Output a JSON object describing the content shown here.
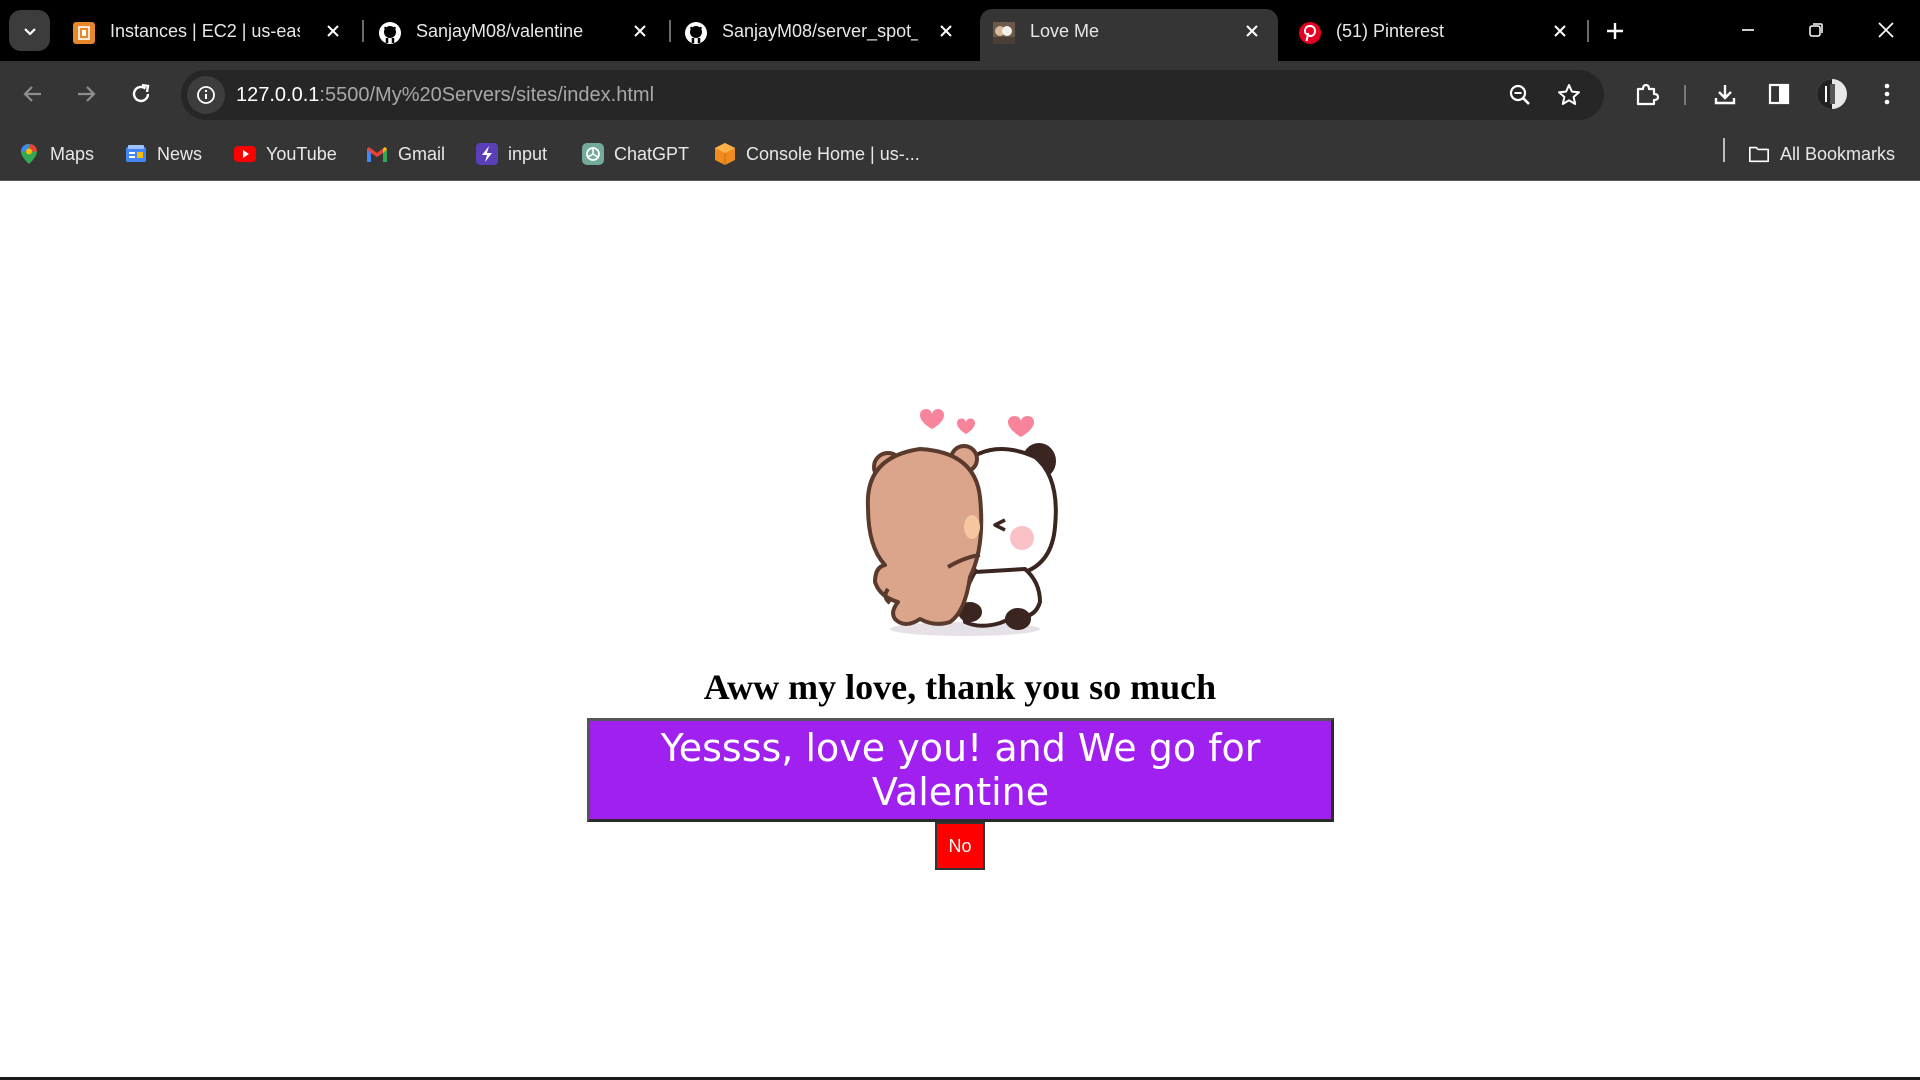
{
  "tabs": [
    {
      "title": "Instances | EC2 | us-east-",
      "icon": "aws-ec2-icon",
      "active": false
    },
    {
      "title": "SanjayM08/valentine",
      "icon": "github-icon",
      "active": false
    },
    {
      "title": "SanjayM08/server_spot_y",
      "icon": "github-icon",
      "active": false
    },
    {
      "title": "Love Me",
      "icon": "page-thumbnail-icon",
      "active": true
    },
    {
      "title": "(51) Pinterest",
      "icon": "pinterest-icon",
      "active": false
    }
  ],
  "address": {
    "host": "127.0.0.1",
    "path": ":5500/My%20Servers/sites/index.html"
  },
  "bookmarks": [
    {
      "label": "Maps",
      "icon": "maps-icon"
    },
    {
      "label": "News",
      "icon": "news-icon"
    },
    {
      "label": "YouTube",
      "icon": "youtube-icon"
    },
    {
      "label": "Gmail",
      "icon": "gmail-icon"
    },
    {
      "label": "input",
      "icon": "input-icon"
    },
    {
      "label": "ChatGPT",
      "icon": "chatgpt-icon"
    },
    {
      "label": "Console Home | us-...",
      "icon": "aws-console-icon"
    }
  ],
  "all_bookmarks": "All Bookmarks",
  "page": {
    "heading": "Aww my love, thank you so much",
    "yes_label": "Yessss, love you! and We go for Valentine",
    "no_label": "No"
  },
  "colors": {
    "yes_button": "#a020f0",
    "no_button": "#ff0000",
    "browser_chrome": "#353535"
  }
}
